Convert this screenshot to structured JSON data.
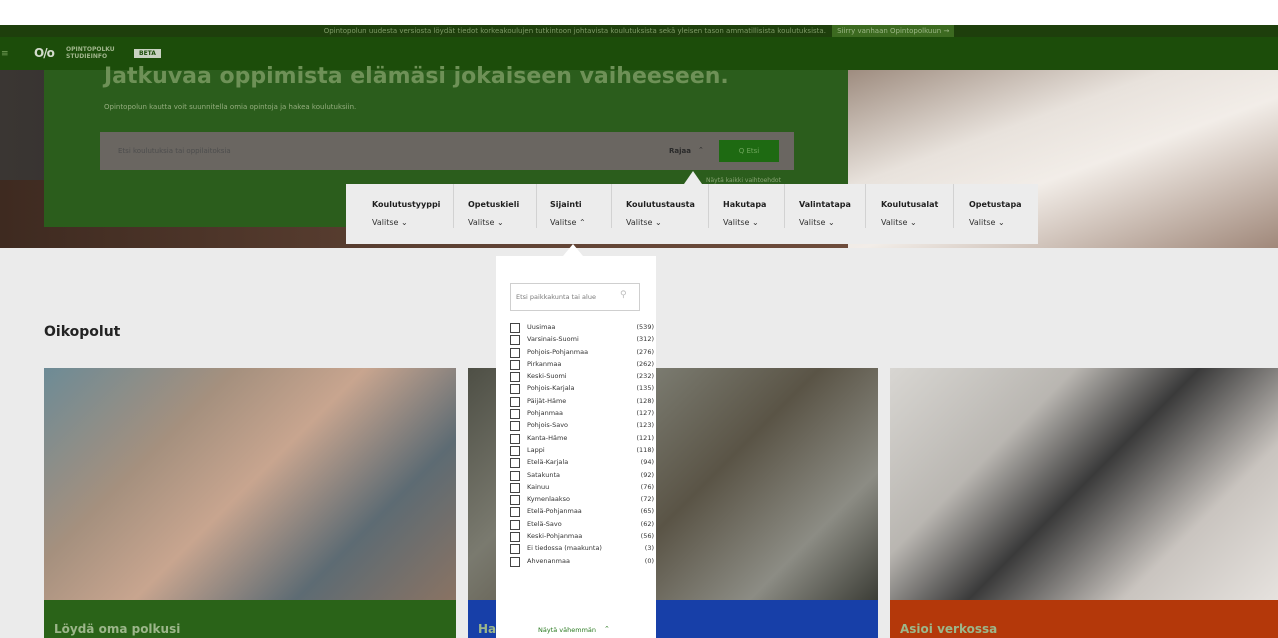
{
  "notice": {
    "text": "Opintopolun uudesta versiosta löydät tiedot korkeakoulujen tutkintoon johtavista koulutuksista sekä yleisen tason ammatillisista koulutuksista.",
    "link": "Siirry vanhaan Opintopolkuun →"
  },
  "header": {
    "menu_icon": "hamburger-icon",
    "logo_mark": "O/o",
    "logo_line1": "OPINTOPOLKU",
    "logo_line2": "STUDIEINFO",
    "beta": "BETA"
  },
  "hero": {
    "title": "Jatkuvaa oppimista elämäsi jokaiseen vaiheeseen.",
    "subtitle": "Opintopolun kautta voit suunnitella omia opintoja ja hakea koulutuksiin.",
    "search_placeholder": "Etsi koulutuksia tai oppilaitoksia",
    "rajaa_label": "Rajaa",
    "search_button": "Q  Etsi",
    "show_all": "Näytä kaikki vaihtoehdot"
  },
  "filters": [
    {
      "label": "Koulutustyyppi",
      "value": "Valitse  ⌄"
    },
    {
      "label": "Opetuskieli",
      "value": "Valitse  ⌄"
    },
    {
      "label": "Sijainti",
      "value": "Valitse  ⌃"
    },
    {
      "label": "Koulutustausta",
      "value": "Valitse  ⌄"
    },
    {
      "label": "Hakutapa",
      "value": "Valitse  ⌄"
    },
    {
      "label": "Valintatapa",
      "value": "Valitse  ⌄"
    },
    {
      "label": "Koulutusalat",
      "value": "Valitse  ⌄"
    },
    {
      "label": "Opetustapa",
      "value": "Valitse  ⌄"
    }
  ],
  "section_title": "Oikopolut",
  "cards": [
    {
      "title": "Löydä oma polkusi",
      "color": "#2a6318"
    },
    {
      "title": "Ha",
      "color": "#173fa8"
    },
    {
      "title": "Asioi verkossa",
      "color": "#b4380a"
    }
  ],
  "dropdown": {
    "search_placeholder": "Etsi paikkakunta tai alue",
    "items": [
      {
        "name": "Uusimaa",
        "count": "(539)"
      },
      {
        "name": "Varsinais-Suomi",
        "count": "(312)"
      },
      {
        "name": "Pohjois-Pohjanmaa",
        "count": "(276)"
      },
      {
        "name": "Pirkanmaa",
        "count": "(262)"
      },
      {
        "name": "Keski-Suomi",
        "count": "(232)"
      },
      {
        "name": "Pohjois-Karjala",
        "count": "(135)"
      },
      {
        "name": "Päijät-Häme",
        "count": "(128)"
      },
      {
        "name": "Pohjanmaa",
        "count": "(127)"
      },
      {
        "name": "Pohjois-Savo",
        "count": "(123)"
      },
      {
        "name": "Kanta-Häme",
        "count": "(121)"
      },
      {
        "name": "Lappi",
        "count": "(118)"
      },
      {
        "name": "Etelä-Karjala",
        "count": "(94)"
      },
      {
        "name": "Satakunta",
        "count": "(92)"
      },
      {
        "name": "Kainuu",
        "count": "(76)"
      },
      {
        "name": "Kymenlaakso",
        "count": "(72)"
      },
      {
        "name": "Etelä-Pohjanmaa",
        "count": "(65)"
      },
      {
        "name": "Etelä-Savo",
        "count": "(62)"
      },
      {
        "name": "Keski-Pohjanmaa",
        "count": "(56)"
      },
      {
        "name": "Ei tiedossa (maakunta)",
        "count": "(3)"
      },
      {
        "name": "Ahvenanmaa",
        "count": "(0)"
      }
    ],
    "show_less": "Näytä vähemmän"
  }
}
